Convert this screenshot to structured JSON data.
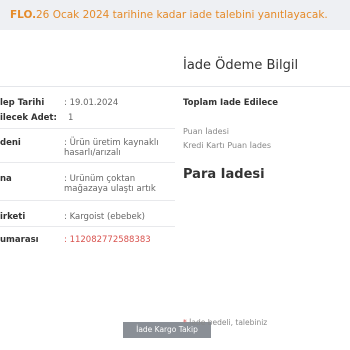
{
  "banner": {
    "prefix": "FLO.",
    "message": "26 Ocak 2024 tarihine kadar iade talebini yanıtlayacak."
  },
  "section_title": "İade Ödeme Bilgil",
  "details": [
    {
      "label": "lep Tarihi",
      "value": ": 19.01.2024"
    },
    {
      "label": "ilecek Adet:",
      "value": "1"
    },
    {
      "label": "deni",
      "value": ": Ürün üretim kaynaklı hasarlı/arızalı"
    },
    {
      "label": "na",
      "value": ": Ürünüm çoktan mağazaya ulaştı artık talebimin gerçekleşmesini"
    },
    {
      "label": "irketi",
      "value": ": Kargoist (ebebek)"
    },
    {
      "label": "umarası",
      "value": ": 112082772588383"
    }
  ],
  "track_button": "İade Kargo Takip",
  "summary": {
    "title": "Toplam İade Edilece",
    "line1": "Puan İadesi",
    "line2": "Kredi Kartı Puan İades"
  },
  "refund_title": "Para İadesi",
  "footnote": {
    "star": "*",
    "text": " İade bedeli, talebiniz"
  }
}
